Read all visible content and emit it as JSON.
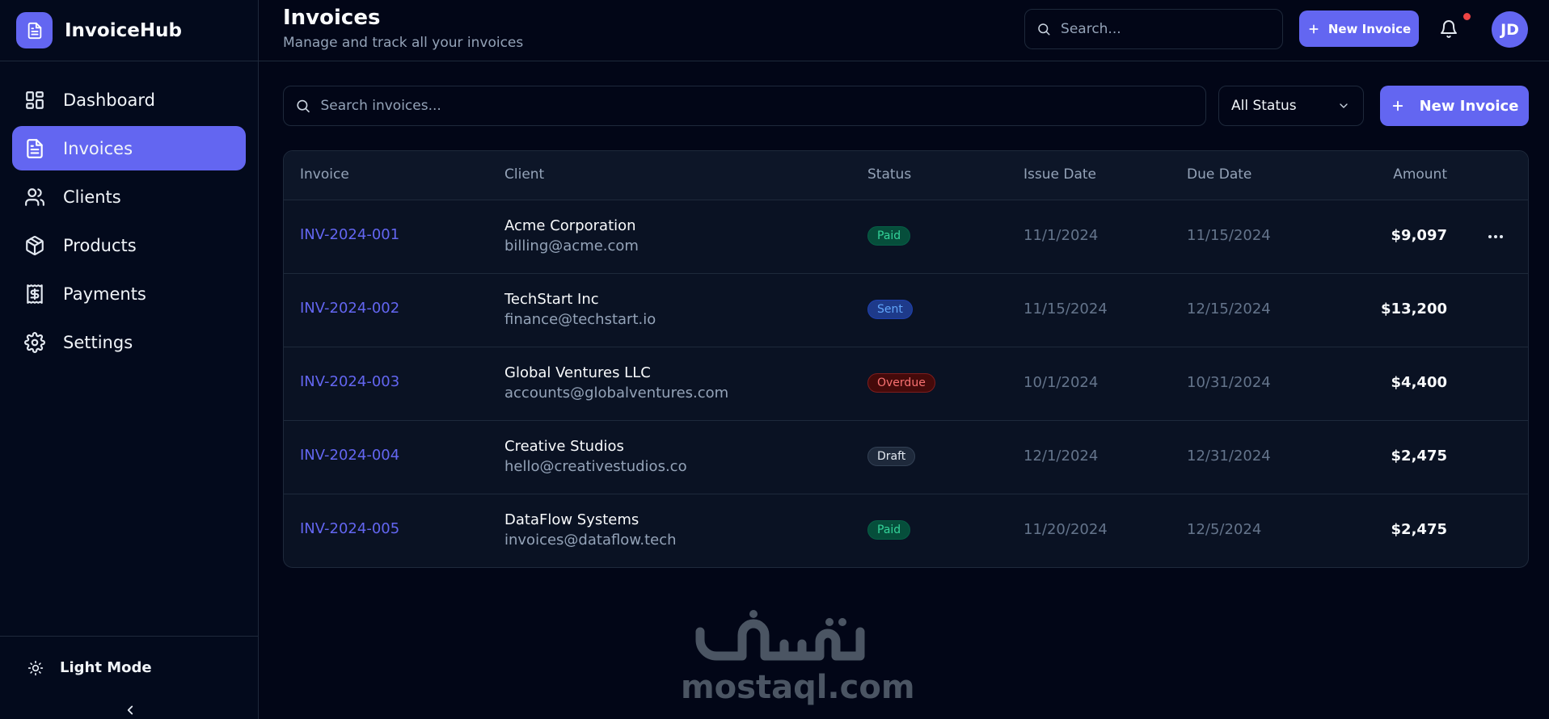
{
  "app": {
    "name": "InvoiceHub"
  },
  "sidebar": {
    "items": [
      {
        "label": "Dashboard",
        "icon": "dashboard-icon",
        "active": false
      },
      {
        "label": "Invoices",
        "icon": "file-icon",
        "active": true
      },
      {
        "label": "Clients",
        "icon": "users-icon",
        "active": false
      },
      {
        "label": "Products",
        "icon": "box-icon",
        "active": false
      },
      {
        "label": "Payments",
        "icon": "receipt-icon",
        "active": false
      },
      {
        "label": "Settings",
        "icon": "gear-icon",
        "active": false
      }
    ],
    "mode_toggle_label": "Light Mode"
  },
  "header": {
    "title": "Invoices",
    "subtitle": "Manage and track all your invoices",
    "search_placeholder": "Search...",
    "new_invoice_label": "New Invoice",
    "avatar_initials": "JD"
  },
  "toolbar": {
    "search_placeholder": "Search invoices...",
    "status_filter": "All Status",
    "new_invoice_label": "New Invoice"
  },
  "table": {
    "columns": [
      "Invoice",
      "Client",
      "Status",
      "Issue Date",
      "Due Date",
      "Amount"
    ],
    "rows": [
      {
        "invoice": "INV-2024-001",
        "client": "Acme Corporation",
        "email": "billing@acme.com",
        "status": "Paid",
        "issue_date": "11/1/2024",
        "due_date": "11/15/2024",
        "amount": "$9,097"
      },
      {
        "invoice": "INV-2024-002",
        "client": "TechStart Inc",
        "email": "finance@techstart.io",
        "status": "Sent",
        "issue_date": "11/15/2024",
        "due_date": "12/15/2024",
        "amount": "$13,200"
      },
      {
        "invoice": "INV-2024-003",
        "client": "Global Ventures LLC",
        "email": "accounts@globalventures.com",
        "status": "Overdue",
        "issue_date": "10/1/2024",
        "due_date": "10/31/2024",
        "amount": "$4,400"
      },
      {
        "invoice": "INV-2024-004",
        "client": "Creative Studios",
        "email": "hello@creativestudios.co",
        "status": "Draft",
        "issue_date": "12/1/2024",
        "due_date": "12/31/2024",
        "amount": "$2,475"
      },
      {
        "invoice": "INV-2024-005",
        "client": "DataFlow Systems",
        "email": "invoices@dataflow.tech",
        "status": "Paid",
        "issue_date": "11/20/2024",
        "due_date": "12/5/2024",
        "amount": "$2,475"
      }
    ]
  },
  "status_colors": {
    "Paid": {
      "text": "#34d399",
      "bg": "#064e3b",
      "border": "#065f46"
    },
    "Sent": {
      "text": "#60a5fa",
      "bg": "#1e3a8a",
      "border": "#1e40af"
    },
    "Overdue": {
      "text": "#f87171",
      "bg": "#450a0a",
      "border": "#7f1d1d"
    },
    "Draft": {
      "text": "#e2e8f0",
      "bg": "#1e293b",
      "border": "#334155"
    }
  },
  "colors": {
    "accent": "#6366f1",
    "background": "#020617",
    "border": "#1e293b"
  },
  "watermark": {
    "arabic": "مستقل",
    "text": "mostaql.com"
  }
}
